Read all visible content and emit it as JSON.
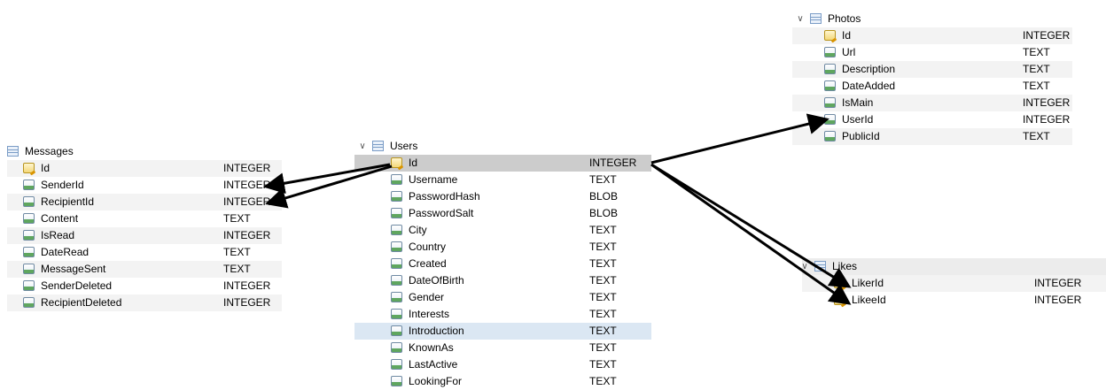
{
  "tables": {
    "messages": {
      "name": "Messages",
      "fields": [
        {
          "name": "Id",
          "type": "INTEGER",
          "key": true
        },
        {
          "name": "SenderId",
          "type": "INTEGER"
        },
        {
          "name": "RecipientId",
          "type": "INTEGER"
        },
        {
          "name": "Content",
          "type": "TEXT"
        },
        {
          "name": "IsRead",
          "type": "INTEGER"
        },
        {
          "name": "DateRead",
          "type": "TEXT"
        },
        {
          "name": "MessageSent",
          "type": "TEXT"
        },
        {
          "name": "SenderDeleted",
          "type": "INTEGER"
        },
        {
          "name": "RecipientDeleted",
          "type": "INTEGER"
        }
      ]
    },
    "users": {
      "name": "Users",
      "fields": [
        {
          "name": "Id",
          "type": "INTEGER",
          "key": true
        },
        {
          "name": "Username",
          "type": "TEXT"
        },
        {
          "name": "PasswordHash",
          "type": "BLOB"
        },
        {
          "name": "PasswordSalt",
          "type": "BLOB"
        },
        {
          "name": "City",
          "type": "TEXT"
        },
        {
          "name": "Country",
          "type": "TEXT"
        },
        {
          "name": "Created",
          "type": "TEXT"
        },
        {
          "name": "DateOfBirth",
          "type": "TEXT"
        },
        {
          "name": "Gender",
          "type": "TEXT"
        },
        {
          "name": "Interests",
          "type": "TEXT"
        },
        {
          "name": "Introduction",
          "type": "TEXT"
        },
        {
          "name": "KnownAs",
          "type": "TEXT"
        },
        {
          "name": "LastActive",
          "type": "TEXT"
        },
        {
          "name": "LookingFor",
          "type": "TEXT"
        }
      ]
    },
    "photos": {
      "name": "Photos",
      "fields": [
        {
          "name": "Id",
          "type": "INTEGER",
          "key": true
        },
        {
          "name": "Url",
          "type": "TEXT"
        },
        {
          "name": "Description",
          "type": "TEXT"
        },
        {
          "name": "DateAdded",
          "type": "TEXT"
        },
        {
          "name": "IsMain",
          "type": "INTEGER"
        },
        {
          "name": "UserId",
          "type": "INTEGER"
        },
        {
          "name": "PublicId",
          "type": "TEXT"
        }
      ]
    },
    "likes": {
      "name": "Likes",
      "fields": [
        {
          "name": "LikerId",
          "type": "INTEGER",
          "key": true
        },
        {
          "name": "LikeeId",
          "type": "INTEGER",
          "key": true
        }
      ]
    }
  },
  "colors": {
    "selected_row": "#cccccc",
    "hover_row": "#dbe7f3",
    "alt_row": "#f3f3f3",
    "arrow": "#000000"
  }
}
